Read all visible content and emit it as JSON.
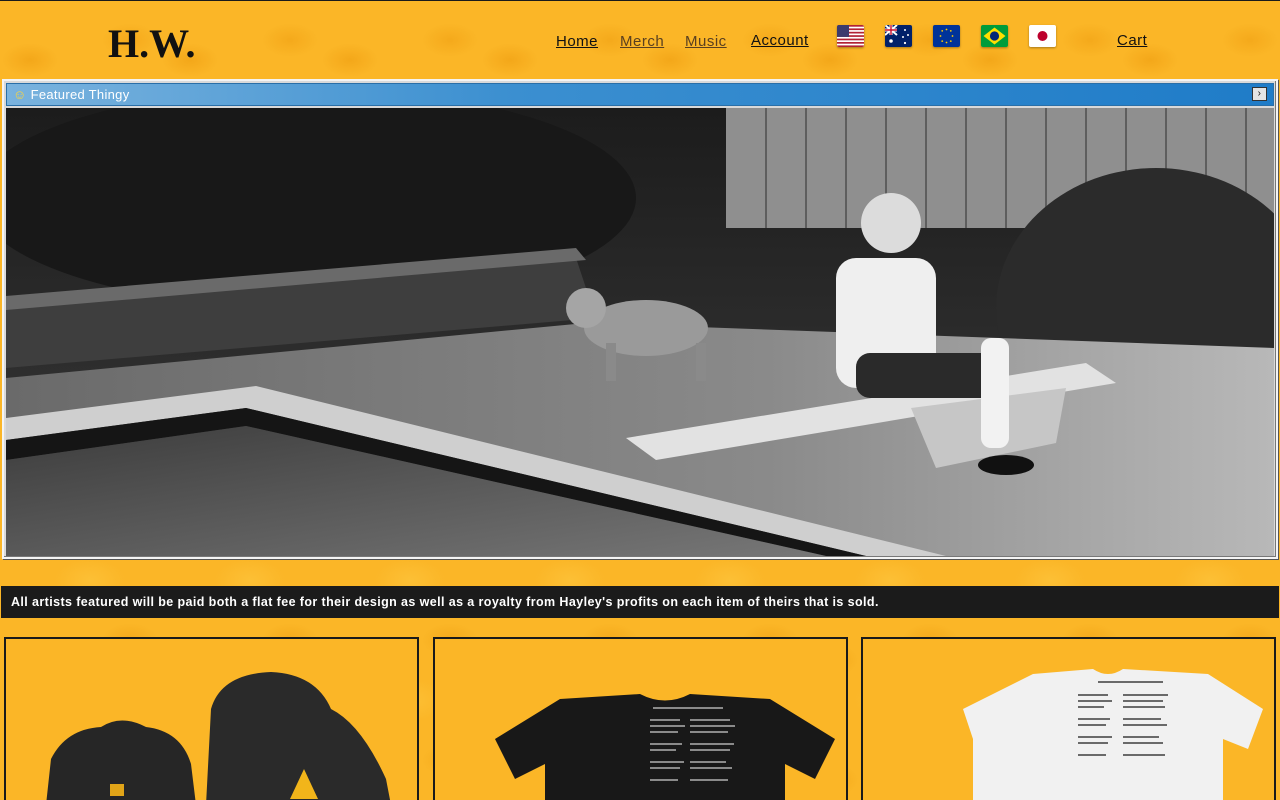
{
  "header": {
    "logo_text": "H.W.",
    "nav": {
      "home": "Home",
      "merch": "Merch",
      "music": "Music",
      "account": "Account",
      "cart": "Cart"
    },
    "flags": [
      "us-flag-icon",
      "australia-flag-icon",
      "eu-flag-icon",
      "brazil-flag-icon",
      "japan-flag-icon"
    ]
  },
  "featured": {
    "title": "Featured Thingy",
    "title_icon": "smiley-icon",
    "next_button": "›",
    "image": "black-and-white photo of a person sitting on a diving board beside a pool with a dog"
  },
  "notice": "All artists featured will be paid both a flat fee for their design as well as a royalty from Hayley's profits on each item of theirs that is sold.",
  "products": [
    {
      "image": "black hoodies"
    },
    {
      "image": "black t-shirt with printed credits"
    },
    {
      "image": "white t-shirt with printed credits"
    }
  ],
  "colors": {
    "background": "#fbb627",
    "notice_bar": "#1b1b1b",
    "titlebar": "#1f7cc8"
  }
}
